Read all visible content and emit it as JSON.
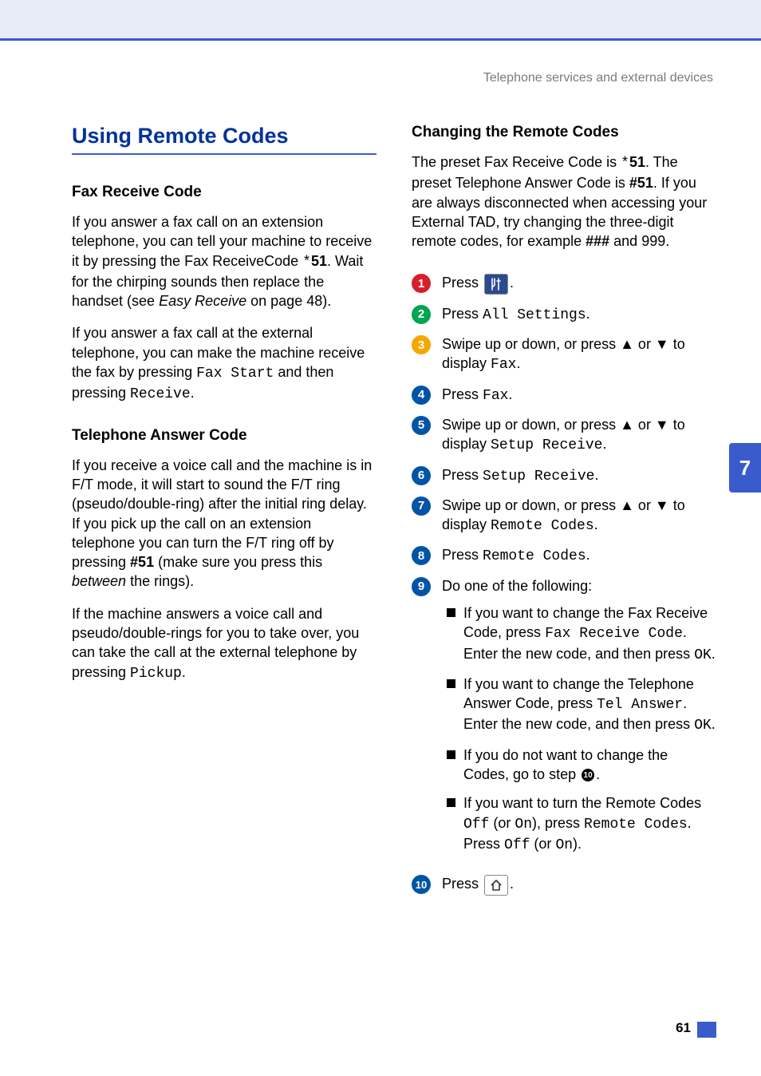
{
  "breadcrumb": "Telephone services and external devices",
  "side_tab": "7",
  "page_number": "61",
  "left": {
    "title": "Using Remote Codes",
    "sub1": "Fax Receive Code",
    "p1a": "If you answer a fax call on an  extension telephone, you can tell your machine to receive it by pressing the Fax ReceiveCode ",
    "p1_code": "*51",
    "p1b": ". Wait for the chirping sounds then replace the handset (see ",
    "p1_italic": "Easy Receive",
    "p1c": " on page 48).",
    "p2a": "If you answer a fax call at the external telephone, you can make the machine receive the fax by pressing ",
    "p2_mono1": "Fax Start",
    "p2b": " and then pressing ",
    "p2_mono2": "Receive",
    "p2c": ".",
    "sub2": "Telephone Answer Code",
    "p3a": "If you receive a voice call and the machine is in F/T mode, it will start to sound the F/T ring (pseudo/double-ring) after the initial ring delay. If you pick up the call on an extension telephone you can turn the F/T ring off by pressing ",
    "p3_bold": "#51",
    "p3b": " (make sure you press this ",
    "p3_italic": "between",
    "p3c": " the rings).",
    "p4a": "If the machine answers a voice call and pseudo/double-rings for you to take over, you can take the call at the external telephone by pressing ",
    "p4_mono": "Pickup",
    "p4b": "."
  },
  "right": {
    "sub1": "Changing the Remote Codes",
    "p1a": "The preset Fax Receive Code is ",
    "p1_code1": "*51",
    "p1b": ". The preset Telephone Answer Code is ",
    "p1_code2": "#51",
    "p1c": ". If you are always disconnected when accessing your External TAD, try changing the three-digit remote codes, for example ",
    "p1_code3": "###",
    "p1d": " and 999.",
    "steps": [
      {
        "n": "1",
        "color": "#d81e2c"
      },
      {
        "n": "2",
        "color": "#00a54f"
      },
      {
        "n": "3",
        "color": "#f7a600"
      },
      {
        "n": "4",
        "color": "#0054a6"
      },
      {
        "n": "5",
        "color": "#0054a6"
      },
      {
        "n": "6",
        "color": "#0054a6"
      },
      {
        "n": "7",
        "color": "#0054a6"
      },
      {
        "n": "8",
        "color": "#0054a6"
      },
      {
        "n": "9",
        "color": "#0054a6"
      },
      {
        "n": "10",
        "color": "#0054a6"
      }
    ],
    "s1_pre": "Press ",
    "s1_post": ".",
    "s2_pre": "Press ",
    "s2_mono": "All Settings",
    "s2_post": ".",
    "s3_pre": "Swipe up or down, or press ▲ or ▼ to display ",
    "s3_mono": "Fax",
    "s3_post": ".",
    "s4_pre": "Press ",
    "s4_mono": "Fax",
    "s4_post": ".",
    "s5_pre": "Swipe up or down, or press ▲ or ▼ to display ",
    "s5_mono": "Setup Receive",
    "s5_post": ".",
    "s6_pre": "Press ",
    "s6_mono": "Setup Receive",
    "s6_post": ".",
    "s7_pre": "Swipe up or down, or press ▲ or ▼ to display ",
    "s7_mono": "Remote Codes",
    "s7_post": ".",
    "s8_pre": "Press ",
    "s8_mono": "Remote Codes",
    "s8_post": ".",
    "s9_text": "Do one of the following:",
    "b1a": "If you want to change the Fax Receive Code, press ",
    "b1_mono1": "Fax Receive Code",
    "b1b": ". Enter the new code, and then press ",
    "b1_mono2": "OK",
    "b1c": ".",
    "b2a": "If you want to change the Telephone Answer Code, press ",
    "b2_mono1": "Tel Answer",
    "b2b": ". Enter the new code, and then press ",
    "b2_mono2": "OK",
    "b2c": ".",
    "b3a": "If you do not want to change the Codes, go to step ",
    "b3_ref": "⓾",
    "b3b": ".",
    "b4a": "If you want to turn the Remote Codes ",
    "b4_mono1": "Off",
    "b4_mid1": " (or ",
    "b4_mono2": "On",
    "b4_mid2": "), press ",
    "b4_mono3": "Remote Codes",
    "b4_mid3": ". Press ",
    "b4_mono4": "Off",
    "b4_mid4": " (or ",
    "b4_mono5": "On",
    "b4_end": ").",
    "s10_pre": "Press ",
    "s10_post": "."
  }
}
